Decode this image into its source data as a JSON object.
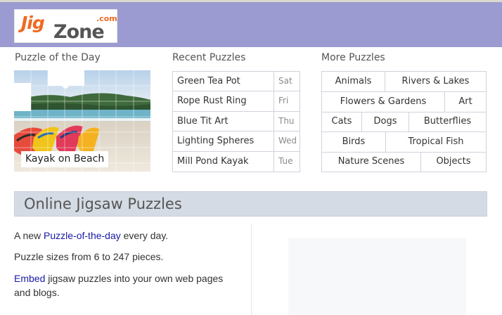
{
  "logo": {
    "jig": "Jig",
    "zone": "Zone",
    "com": ".com"
  },
  "potd": {
    "title": "Puzzle of the Day",
    "caption": "Kayak on Beach"
  },
  "recent": {
    "title": "Recent Puzzles",
    "items": [
      {
        "name": "Green Tea Pot",
        "day": "Sat"
      },
      {
        "name": "Rope Rust Ring",
        "day": "Fri"
      },
      {
        "name": "Blue Tit Art",
        "day": "Thu"
      },
      {
        "name": "Lighting Spheres",
        "day": "Wed"
      },
      {
        "name": "Mill Pond Kayak",
        "day": "Tue"
      }
    ]
  },
  "more": {
    "title": "More Puzzles",
    "rows": [
      [
        "Animals",
        "Rivers & Lakes"
      ],
      [
        "Flowers & Gardens",
        "Art"
      ],
      [
        "Cats",
        "Dogs",
        "Butterflies"
      ],
      [
        "Birds",
        "Tropical Fish"
      ],
      [
        "Nature Scenes",
        "Objects"
      ]
    ]
  },
  "section": {
    "title": "Online Jigsaw Puzzles"
  },
  "intro": {
    "p1_pre": "A new ",
    "p1_link": "Puzzle-of-the-day",
    "p1_post": " every day.",
    "p2": "Puzzle sizes from 6 to 247 pieces.",
    "p3_link": "Embed",
    "p3_post": " jigsaw puzzles into your own web pages and blogs."
  },
  "colors": {
    "header_bg": "#9b9bd1",
    "logo_orange": "#ef6a21",
    "link_blue": "#1a1aa6",
    "section_bar": "#d5dbe4"
  }
}
